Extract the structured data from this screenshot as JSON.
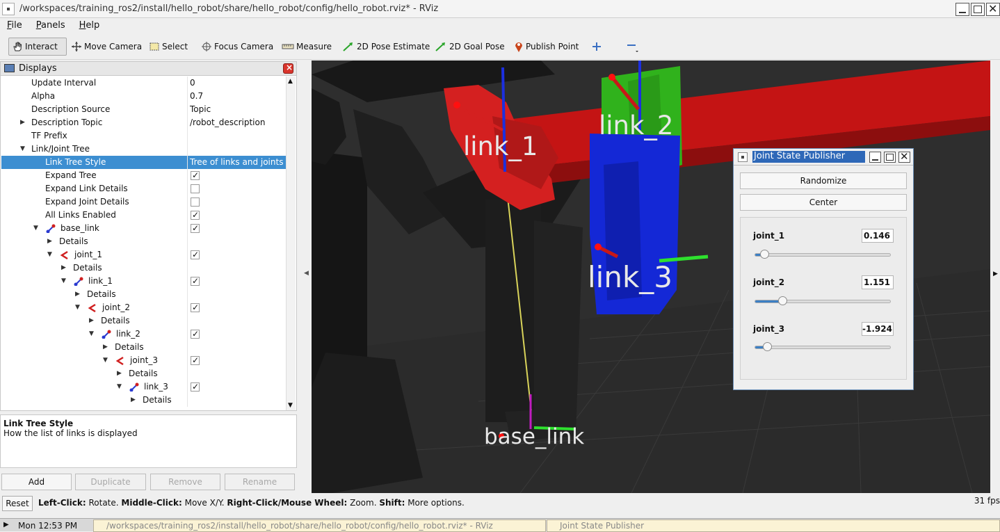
{
  "window": {
    "title": "/workspaces/training_ros2/install/hello_robot/share/hello_robot/config/hello_robot.rviz* - RViz"
  },
  "menu": [
    "File",
    "Panels",
    "Help"
  ],
  "toolbar": {
    "interact": "Interact",
    "move_camera": "Move Camera",
    "select": "Select",
    "focus_camera": "Focus Camera",
    "measure": "Measure",
    "pose_estimate": "2D Pose Estimate",
    "goal_pose": "2D Goal Pose",
    "publish_point": "Publish Point"
  },
  "displays": {
    "title": "Displays",
    "rows": [
      {
        "name": "Update Interval",
        "value": "0"
      },
      {
        "name": "Alpha",
        "value": "0.7"
      },
      {
        "name": "Description Source",
        "value": "Topic"
      },
      {
        "name": "Description Topic",
        "value": "/robot_description"
      },
      {
        "name": "TF Prefix",
        "value": ""
      },
      {
        "name": "Link/Joint Tree",
        "value": ""
      },
      {
        "name": "Link Tree Style",
        "value": "Tree of links and joints"
      },
      {
        "name": "Expand Tree",
        "checked": true
      },
      {
        "name": "Expand Link Details",
        "checked": false
      },
      {
        "name": "Expand Joint Details",
        "checked": false
      },
      {
        "name": "All Links Enabled",
        "checked": true
      },
      {
        "name": "base_link",
        "checked": true
      },
      {
        "name": "Details"
      },
      {
        "name": "joint_1",
        "checked": true
      },
      {
        "name": "Details"
      },
      {
        "name": "link_1",
        "checked": true
      },
      {
        "name": "Details"
      },
      {
        "name": "joint_2",
        "checked": true
      },
      {
        "name": "Details"
      },
      {
        "name": "link_2",
        "checked": true
      },
      {
        "name": "Details"
      },
      {
        "name": "joint_3",
        "checked": true
      },
      {
        "name": "Details"
      },
      {
        "name": "link_3",
        "checked": true
      },
      {
        "name": "Details"
      }
    ]
  },
  "description": {
    "title": "Link Tree Style",
    "text": "How the list of links is displayed"
  },
  "panel_buttons": {
    "add": "Add",
    "duplicate": "Duplicate",
    "remove": "Remove",
    "rename": "Rename"
  },
  "viewport": {
    "labels": {
      "link_1": "link_1",
      "link_2": "link_2",
      "link_3": "link_3",
      "base_link": "base_link"
    }
  },
  "jsp": {
    "title": "Joint State Publisher",
    "randomize": "Randomize",
    "center": "Center",
    "joints": [
      {
        "name": "joint_1",
        "value": "0.146",
        "fraction": 0.04
      },
      {
        "name": "joint_2",
        "value": "1.151",
        "fraction": 0.18
      },
      {
        "name": "joint_3",
        "value": "-1.924",
        "fraction": 0.06
      }
    ]
  },
  "status": {
    "reset": "Reset",
    "help": [
      {
        "b": "Left-Click:",
        "t": " Rotate. "
      },
      {
        "b": "Middle-Click:",
        "t": " Move X/Y. "
      },
      {
        "b": "Right-Click/Mouse Wheel:",
        "t": " Zoom. "
      },
      {
        "b": "Shift:",
        "t": " More options."
      }
    ],
    "fps": "31 fps"
  },
  "taskbar": {
    "clock": "Mon 12:53 PM",
    "tasks": [
      "/workspaces/training_ros2/install/hello_robot/share/hello_robot/config/hello_robot.rviz* - RViz",
      "Joint State Publisher"
    ]
  },
  "colors": {
    "selection": "#3c8ed1",
    "link_red": "#d01818",
    "link_green": "#2fa61c",
    "link_blue": "#1024d8"
  }
}
